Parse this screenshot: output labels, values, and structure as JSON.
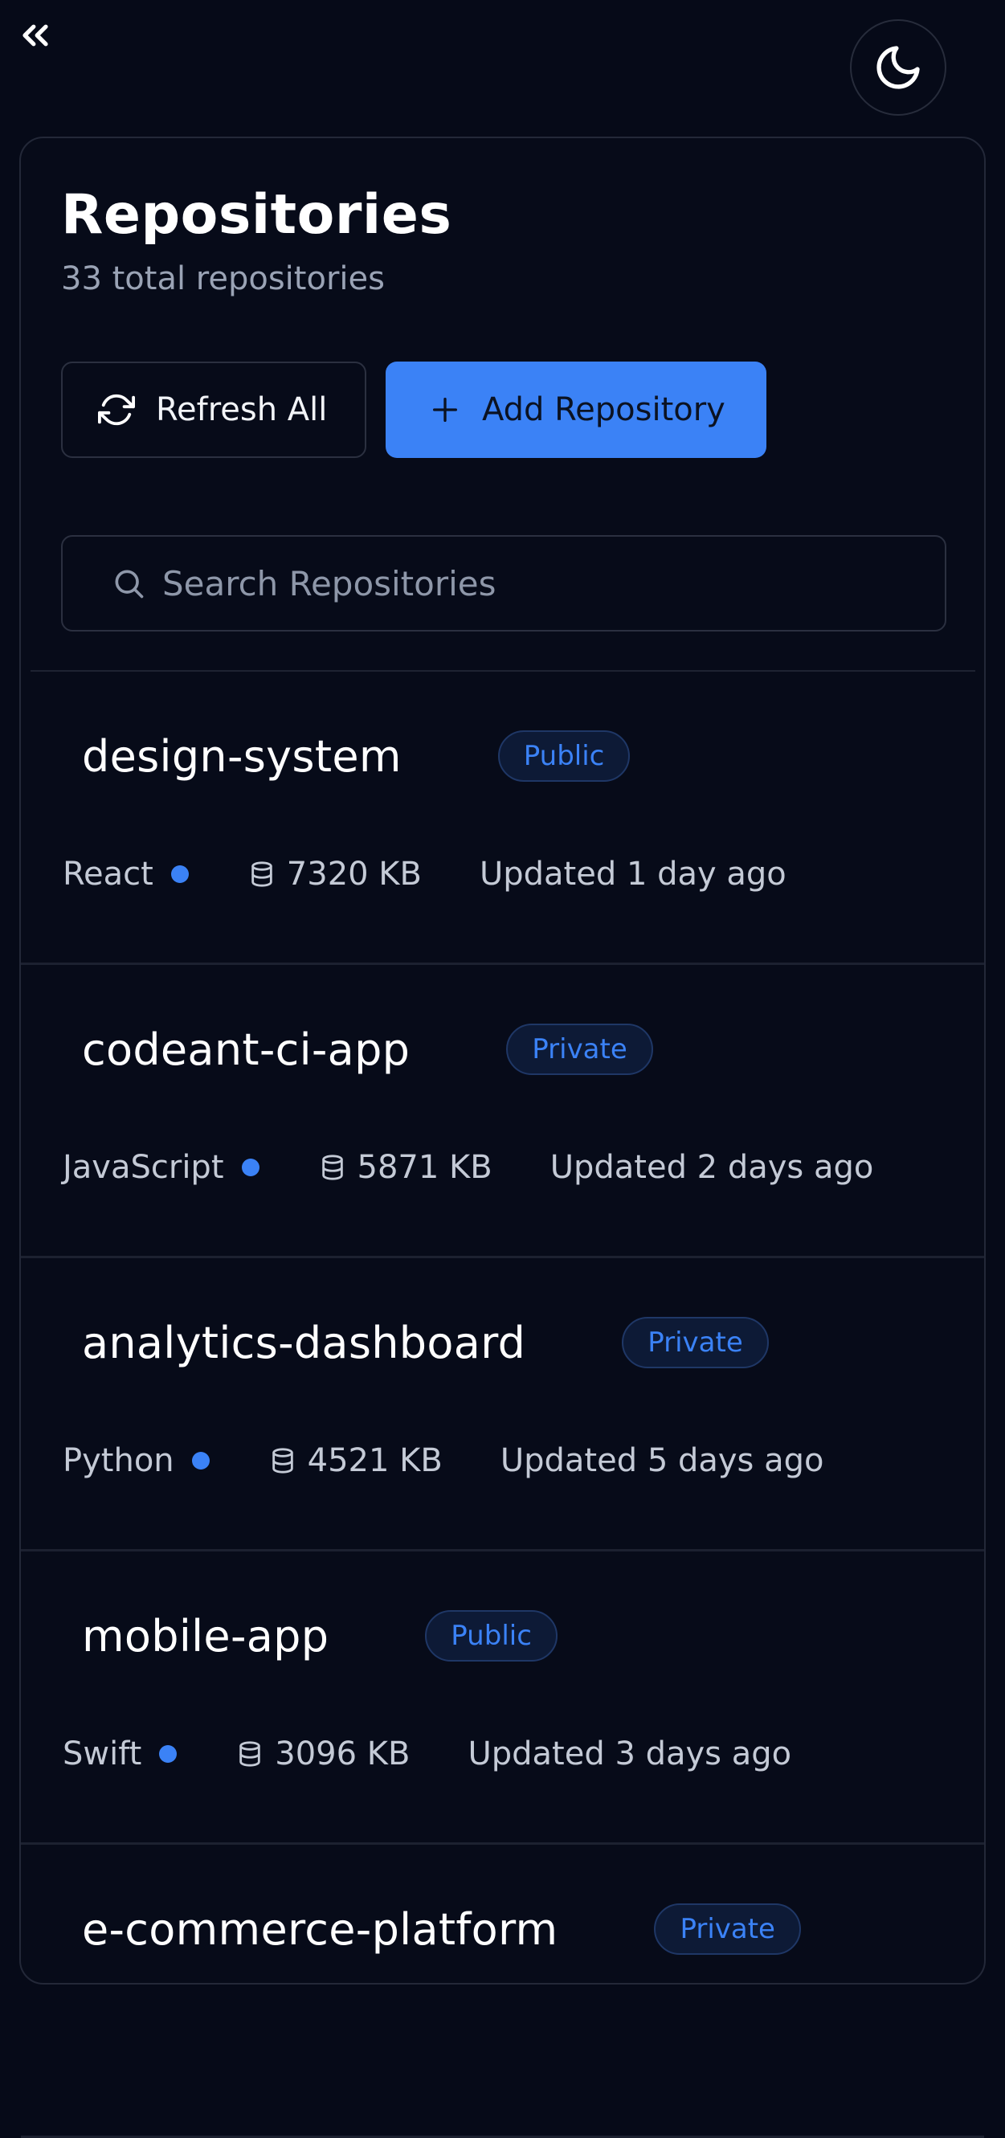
{
  "header": {
    "collapse_icon": "chevrons-left-icon",
    "theme_icon": "moon-icon"
  },
  "page": {
    "title": "Repositories",
    "subtitle": "33 total repositories"
  },
  "actions": {
    "refresh_label": "Refresh All",
    "add_label": "Add Repository"
  },
  "search": {
    "placeholder": "Search Repositories",
    "value": ""
  },
  "colors": {
    "accent": "#3b82f6",
    "background": "#060a18"
  },
  "repositories": [
    {
      "name": "design-system",
      "visibility": "Public",
      "language": "React",
      "size": "7320 KB",
      "updated": "Updated 1 day ago"
    },
    {
      "name": "codeant-ci-app",
      "visibility": "Private",
      "language": "JavaScript",
      "size": "5871 KB",
      "updated": "Updated 2 days ago"
    },
    {
      "name": "analytics-dashboard",
      "visibility": "Private",
      "language": "Python",
      "size": "4521 KB",
      "updated": "Updated 5 days ago"
    },
    {
      "name": "mobile-app",
      "visibility": "Public",
      "language": "Swift",
      "size": "3096 KB",
      "updated": "Updated 3 days ago"
    },
    {
      "name": "e-commerce-platform",
      "visibility": "Private",
      "language": "",
      "size": "",
      "updated": ""
    }
  ]
}
